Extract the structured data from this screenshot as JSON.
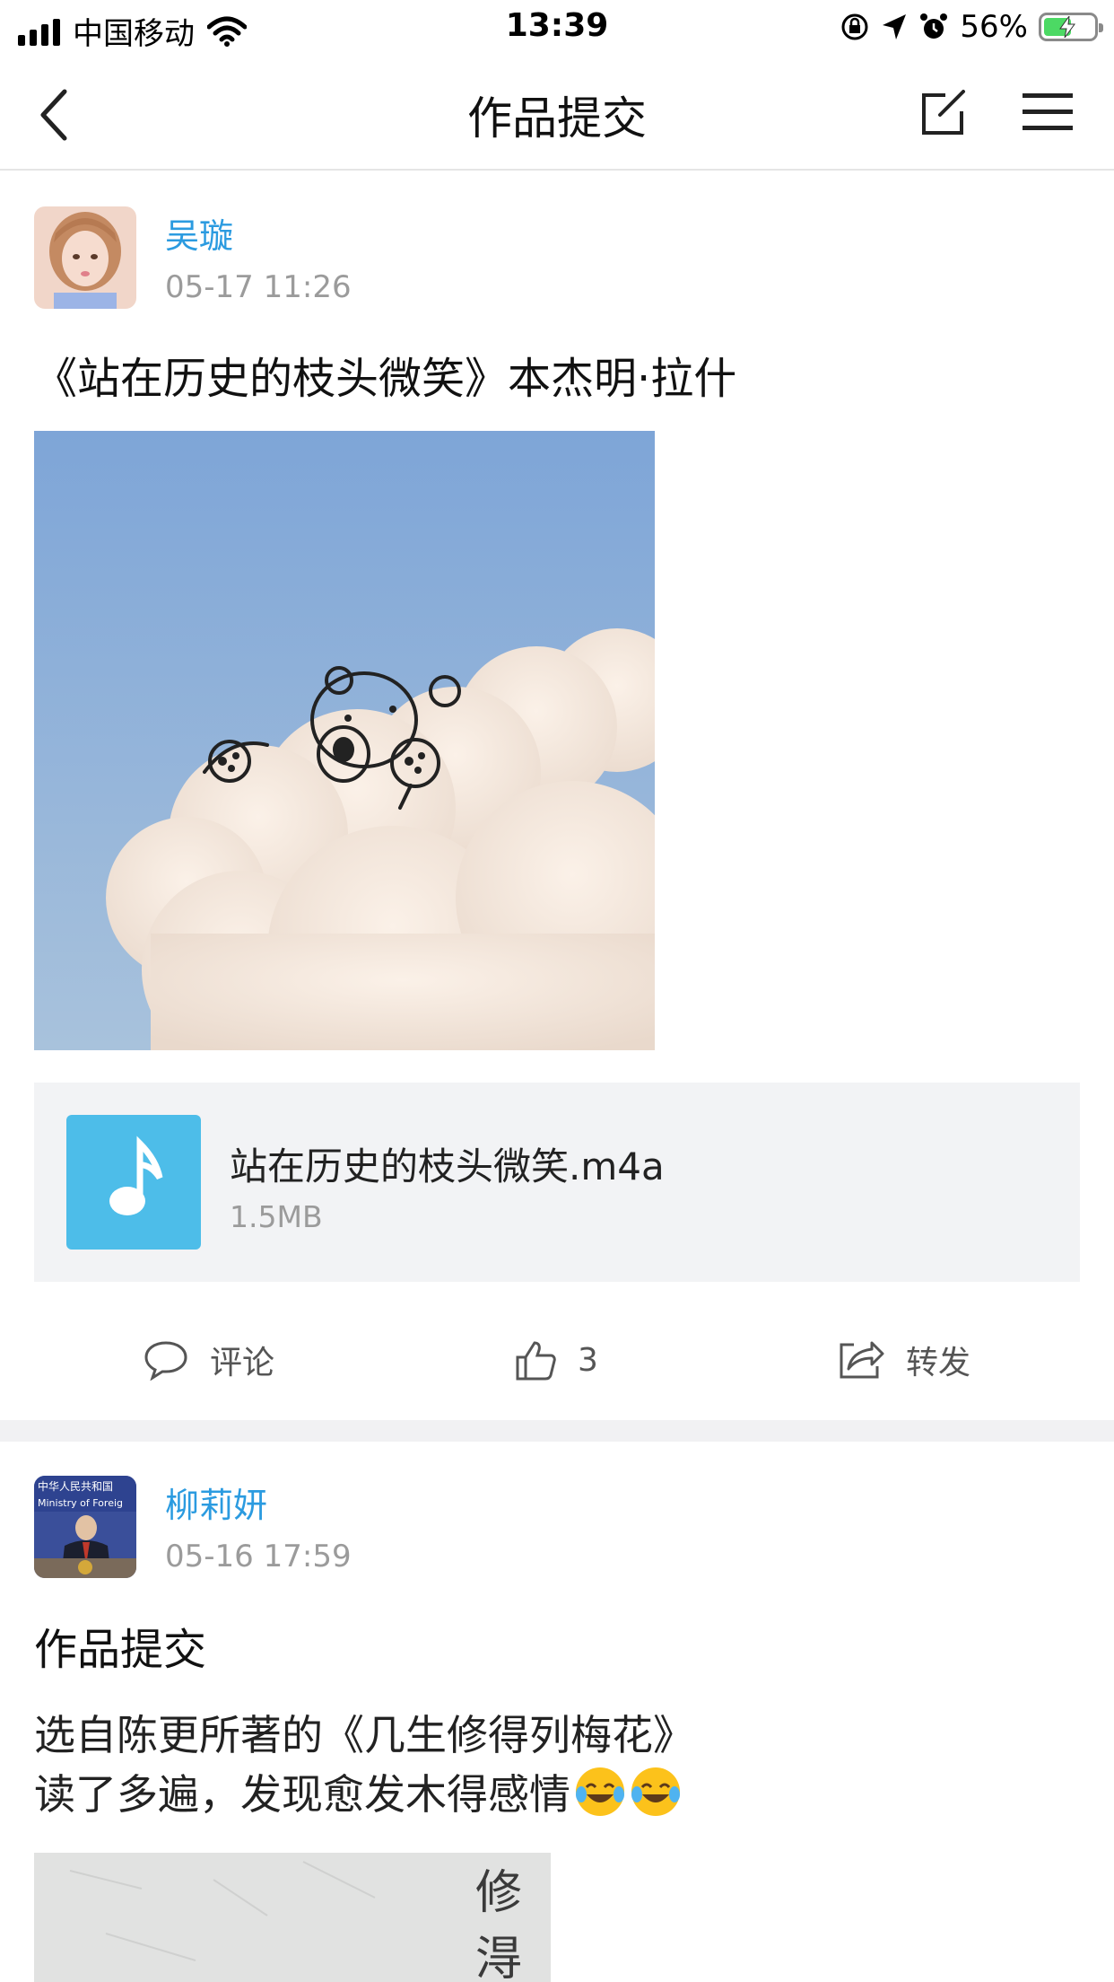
{
  "status_bar": {
    "carrier": "中国移动",
    "time": "13:39",
    "battery_percent": "56%",
    "battery_level": 0.56,
    "icons": [
      "signal-icon",
      "wifi-icon",
      "rotation-lock-icon",
      "location-icon",
      "alarm-icon",
      "battery-icon"
    ]
  },
  "nav": {
    "title": "作品提交",
    "icons": [
      "back-icon",
      "edit-icon",
      "menu-icon"
    ]
  },
  "posts": [
    {
      "author": "吴璇",
      "time": "05-17 11:26",
      "title": "《站在历史的枝头微笑》本杰明·拉什",
      "attachment": {
        "name": "站在历史的枝头微笑.m4a",
        "size": "1.5MB",
        "icon": "music-note-icon"
      },
      "actions": {
        "comment_label": "评论",
        "like_count": "3",
        "share_label": "转发"
      }
    },
    {
      "author": "柳莉妍",
      "time": "05-16 17:59",
      "title": "作品提交",
      "body_line1": "选自陈更所著的《几生修得列梅花》",
      "body_line2": "读了多遍，发现愈发木得感情",
      "emoji": "tears-of-joy-emoji",
      "photo_text": "修 淂",
      "avatar_text": "中华人民共和国 Ministry of Foreign"
    }
  ]
}
